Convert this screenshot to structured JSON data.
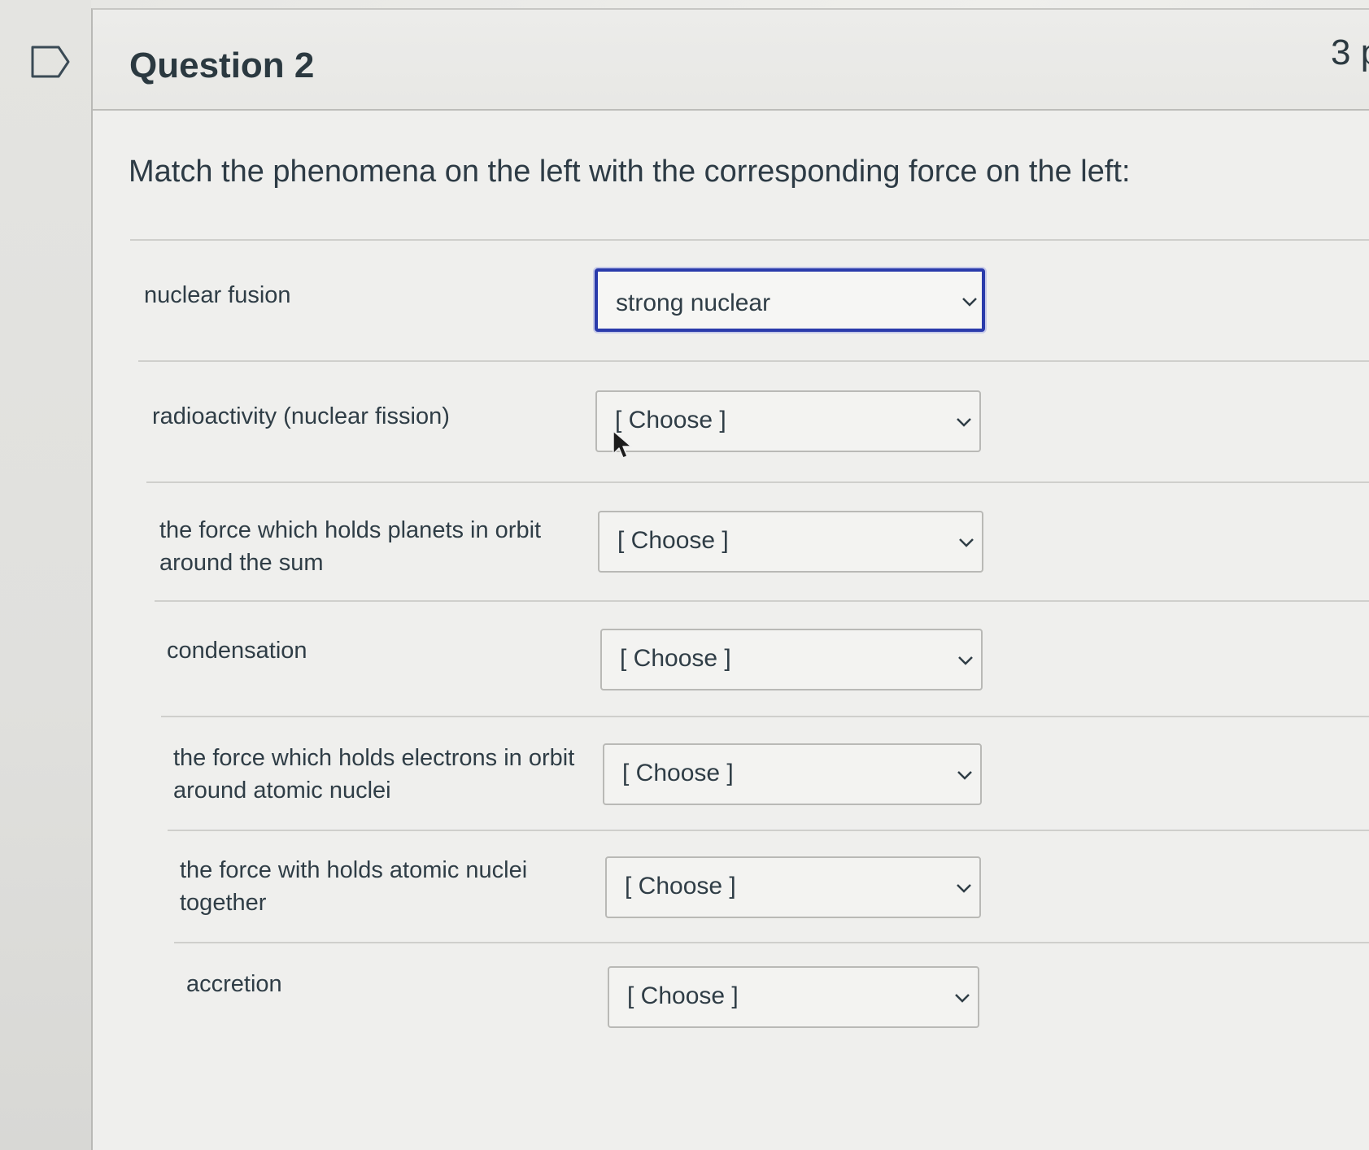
{
  "question": {
    "title": "Question 2",
    "points": "3 p",
    "prompt": "Match the phenomena on the left with the corresponding force on the left:"
  },
  "matches": [
    {
      "label": "nuclear fusion",
      "selected": "strong nuclear",
      "focused": true
    },
    {
      "label": "radioactivity (nuclear fission)",
      "selected": "[ Choose ]",
      "focused": false
    },
    {
      "label": "the force which holds planets in orbit around the sum",
      "selected": "[ Choose ]",
      "focused": false
    },
    {
      "label": "condensation",
      "selected": "[ Choose ]",
      "focused": false
    },
    {
      "label": "the force which holds electrons in orbit around atomic nuclei",
      "selected": "[ Choose ]",
      "focused": false
    },
    {
      "label": "the force with holds atomic nuclei together",
      "selected": "[ Choose ]",
      "focused": false
    },
    {
      "label": "accretion",
      "selected": "[ Choose ]",
      "focused": false
    }
  ],
  "icons": {
    "flag": "flag-outline-icon",
    "chevron": "chevron-down-icon",
    "cursor": "mouse-pointer-icon"
  },
  "colors": {
    "focus_border": "#2a3bab",
    "text": "#2d3b45",
    "divider": "#cfcfcc"
  }
}
